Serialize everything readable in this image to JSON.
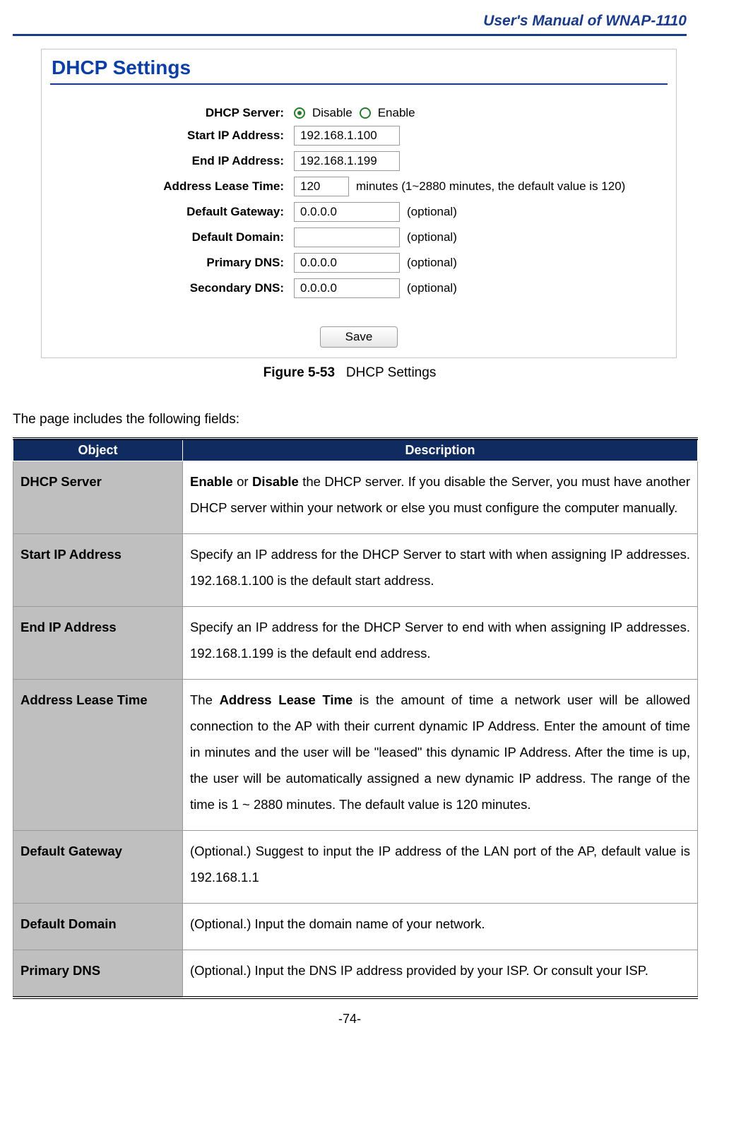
{
  "header": "User's Manual of WNAP-1110",
  "panel": {
    "title": "DHCP Settings",
    "rows": {
      "dhcp_server": {
        "label": "DHCP Server:",
        "disable": "Disable",
        "enable": "Enable",
        "checked": "disable"
      },
      "start_ip": {
        "label": "Start IP Address:",
        "value": "192.168.1.100"
      },
      "end_ip": {
        "label": "End IP Address:",
        "value": "192.168.1.199"
      },
      "lease": {
        "label": "Address Lease Time:",
        "value": "120",
        "hint": "minutes (1~2880 minutes, the default value is 120)"
      },
      "gateway": {
        "label": "Default Gateway:",
        "value": "0.0.0.0",
        "hint": "(optional)"
      },
      "domain": {
        "label": "Default Domain:",
        "value": "",
        "hint": "(optional)"
      },
      "pdns": {
        "label": "Primary DNS:",
        "value": "0.0.0.0",
        "hint": "(optional)"
      },
      "sdns": {
        "label": "Secondary DNS:",
        "value": "0.0.0.0",
        "hint": "(optional)"
      }
    },
    "save": "Save"
  },
  "figure": {
    "num": "Figure 5-53",
    "caption": "DHCP Settings"
  },
  "intro": "The page includes the following fields:",
  "table": {
    "head_object": "Object",
    "head_desc": "Description",
    "rows": [
      {
        "obj": "DHCP Server",
        "desc_html": "<b>Enable</b> or <b>Disable</b> the DHCP server. If you disable the Server, you must have another DHCP server within your network or else you must configure the computer manually."
      },
      {
        "obj": "Start IP Address",
        "desc_html": "Specify an IP address for the DHCP Server to start with when assigning IP addresses. 192.168.1.100 is the default start address."
      },
      {
        "obj": "End IP Address",
        "desc_html": "Specify an IP address for the DHCP Server to end with when assigning IP addresses. 192.168.1.199 is the default end address."
      },
      {
        "obj": "Address Lease Time",
        "desc_html": "The <b>Address Lease Time</b> is the amount of time a network user will be allowed connection to the AP with their current dynamic IP Address. Enter the amount of time in minutes and the user will be \"leased\" this dynamic IP Address. After the time is up, the user will be automatically assigned a new dynamic IP address. The range of the time is 1 ~ 2880 minutes. The default value is 120 minutes."
      },
      {
        "obj": "Default Gateway",
        "desc_html": "(Optional.) Suggest to input the IP address of the LAN port of the AP, default value is 192.168.1.1"
      },
      {
        "obj": "Default Domain",
        "desc_html": "(Optional.) Input the domain name of your network."
      },
      {
        "obj": "Primary DNS",
        "desc_html": "(Optional.) Input the DNS IP address provided by your ISP. Or consult your ISP."
      }
    ]
  },
  "page_num": "-74-"
}
